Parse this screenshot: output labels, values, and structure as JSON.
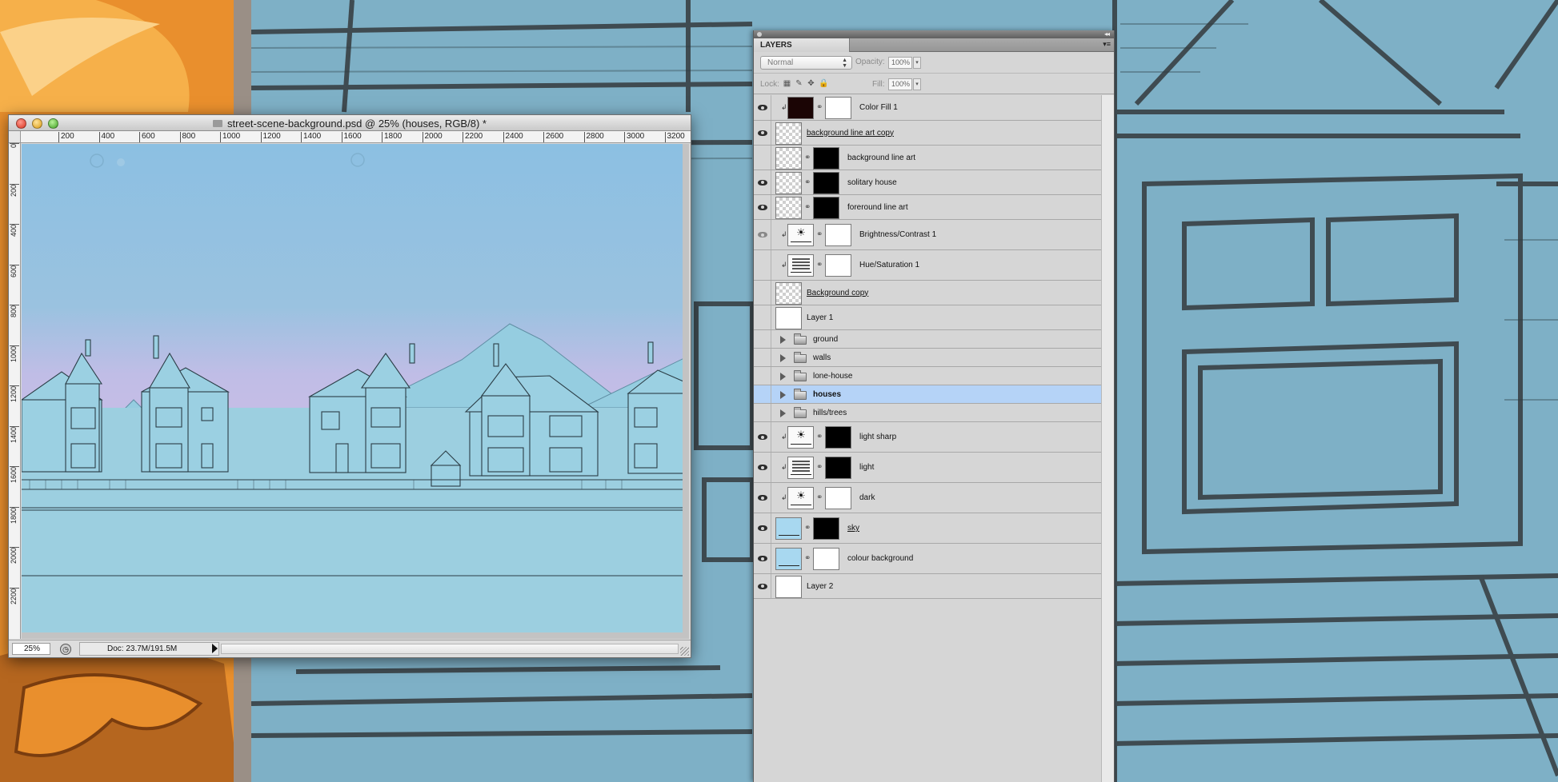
{
  "document": {
    "title": "street-scene-background.psd @ 25% (houses, RGB/8) *",
    "zoom": "25%",
    "doc_size": "Doc: 23.7M/191.5M",
    "ruler_h": [
      "200",
      "400",
      "600",
      "800",
      "1000",
      "1200",
      "1400",
      "1600",
      "1800",
      "2000",
      "2200",
      "2400",
      "2600",
      "2800",
      "3000",
      "3200"
    ],
    "ruler_v": [
      "0",
      "200",
      "400",
      "600",
      "800",
      "1000",
      "1200",
      "1400",
      "1600",
      "1800",
      "2000",
      "2200"
    ]
  },
  "layers_panel": {
    "tab_label": "LAYERS",
    "blend_mode": "Normal",
    "opacity_label": "Opacity:",
    "opacity_value": "100%",
    "lock_label": "Lock:",
    "fill_label": "Fill:",
    "fill_value": "100%",
    "layers": [
      {
        "name": "Color Fill 1",
        "visible": true,
        "kind": "fill",
        "clipped": true
      },
      {
        "name": "background line art copy",
        "visible": true,
        "kind": "pixel",
        "underlined": true
      },
      {
        "name": "background line art",
        "visible": false,
        "kind": "pixel-mask"
      },
      {
        "name": "solitary house",
        "visible": true,
        "kind": "pixel-mask"
      },
      {
        "name": "foreround line art",
        "visible": true,
        "kind": "pixel-mask"
      },
      {
        "name": "Brightness/Contrast 1",
        "visible": true,
        "kind": "adjust-sun",
        "clipped": true,
        "dim": true
      },
      {
        "name": "Hue/Saturation 1",
        "visible": false,
        "kind": "adjust-bars",
        "clipped": true
      },
      {
        "name": "Background copy",
        "visible": false,
        "kind": "pixel",
        "underlined": true
      },
      {
        "name": "Layer 1",
        "visible": false,
        "kind": "white"
      },
      {
        "name": "ground",
        "visible": false,
        "kind": "group"
      },
      {
        "name": "walls",
        "visible": false,
        "kind": "group"
      },
      {
        "name": "lone-house",
        "visible": false,
        "kind": "group"
      },
      {
        "name": "houses",
        "visible": false,
        "kind": "group",
        "selected": true
      },
      {
        "name": "hills/trees",
        "visible": false,
        "kind": "group"
      },
      {
        "name": "light sharp",
        "visible": true,
        "kind": "adjust-sun",
        "clipped": true
      },
      {
        "name": "light",
        "visible": true,
        "kind": "adjust-bars",
        "clipped": true
      },
      {
        "name": "dark",
        "visible": true,
        "kind": "adjust-sun",
        "clipped": true
      },
      {
        "name": "sky",
        "visible": true,
        "kind": "sky",
        "underlined": true
      },
      {
        "name": "colour background",
        "visible": true,
        "kind": "sky-white"
      },
      {
        "name": "Layer 2",
        "visible": true,
        "kind": "white"
      }
    ]
  },
  "colors": {
    "selection": "#b5d3f7",
    "canvas_sky": "#8fc0e0",
    "background_orange": "#e8902f"
  }
}
